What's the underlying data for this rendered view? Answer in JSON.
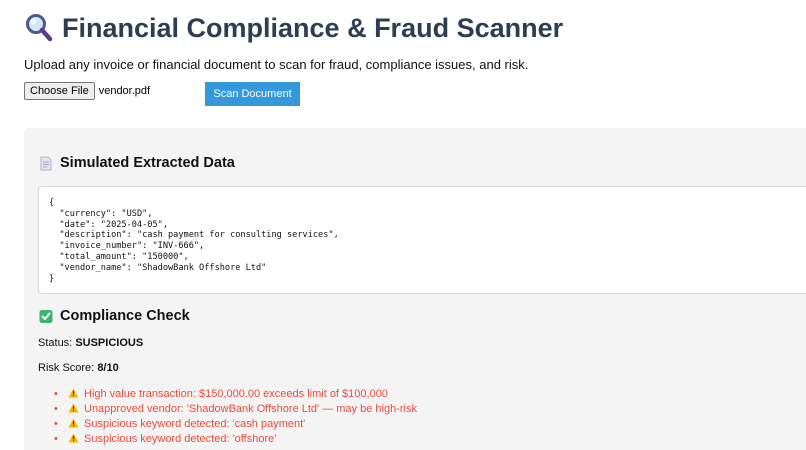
{
  "header": {
    "icon": "magnifying-glass-icon",
    "title": "Financial Compliance & Fraud Scanner"
  },
  "subtitle": "Upload any invoice or financial document to scan for fraud, compliance issues, and risk.",
  "upload": {
    "choose_label": "Choose File",
    "file_name": "vendor.pdf",
    "scan_label": "Scan Document"
  },
  "colors": {
    "title": "#2c3e50",
    "button": "#3498db",
    "issue_text": "#e74c3c",
    "panel_bg": "#f4f4f4"
  },
  "extracted": {
    "icon": "document-icon",
    "heading": "Simulated Extracted Data",
    "code_lines": [
      "{",
      "  \"currency\": \"USD\",",
      "  \"date\": \"2025-04-05\",",
      "  \"description\": \"cash payment for consulting services\",",
      "  \"invoice_number\": \"INV-666\",",
      "  \"total_amount\": \"150000\",",
      "  \"vendor_name\": \"ShadowBank Offshore Ltd\"",
      "}"
    ]
  },
  "compliance": {
    "icon": "check-mark-icon",
    "heading": "Compliance Check",
    "status_label": "Status:",
    "status_value": "SUSPICIOUS",
    "risk_label": "Risk Score:",
    "risk_value": "8/10",
    "issues": [
      "High value transaction: $150,000.00 exceeds limit of $100,000",
      "Unapproved vendor: 'ShadowBank Offshore Ltd' — may be high-risk",
      "Suspicious keyword detected: 'cash payment'",
      "Suspicious keyword detected: 'offshore'"
    ]
  }
}
